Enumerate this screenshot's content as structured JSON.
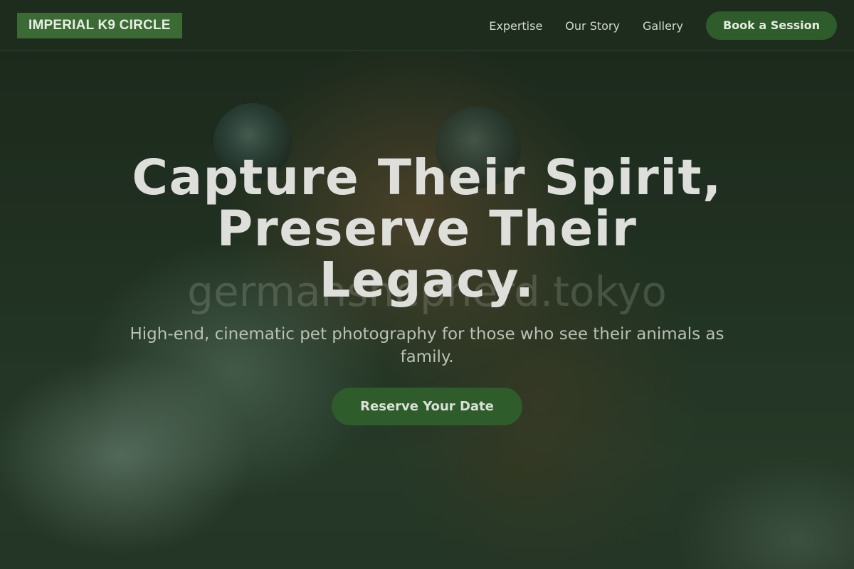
{
  "header": {
    "brand": "IMPERIAL K9 CIRCLE",
    "nav": [
      {
        "label": "Expertise"
      },
      {
        "label": "Our Story"
      },
      {
        "label": "Gallery"
      }
    ],
    "book_button": "Book a Session"
  },
  "hero": {
    "watermark": "germanshepherd.tokyo",
    "title": "Capture Their Spirit, Preserve Their Legacy.",
    "subtitle": "High-end, cinematic pet photography for those who see their animals as family.",
    "cta": "Reserve Your Date"
  },
  "colors": {
    "accent": "#2f5c2b",
    "brand_bg": "#3b6a34",
    "header_bg": "#1e2d1e"
  }
}
